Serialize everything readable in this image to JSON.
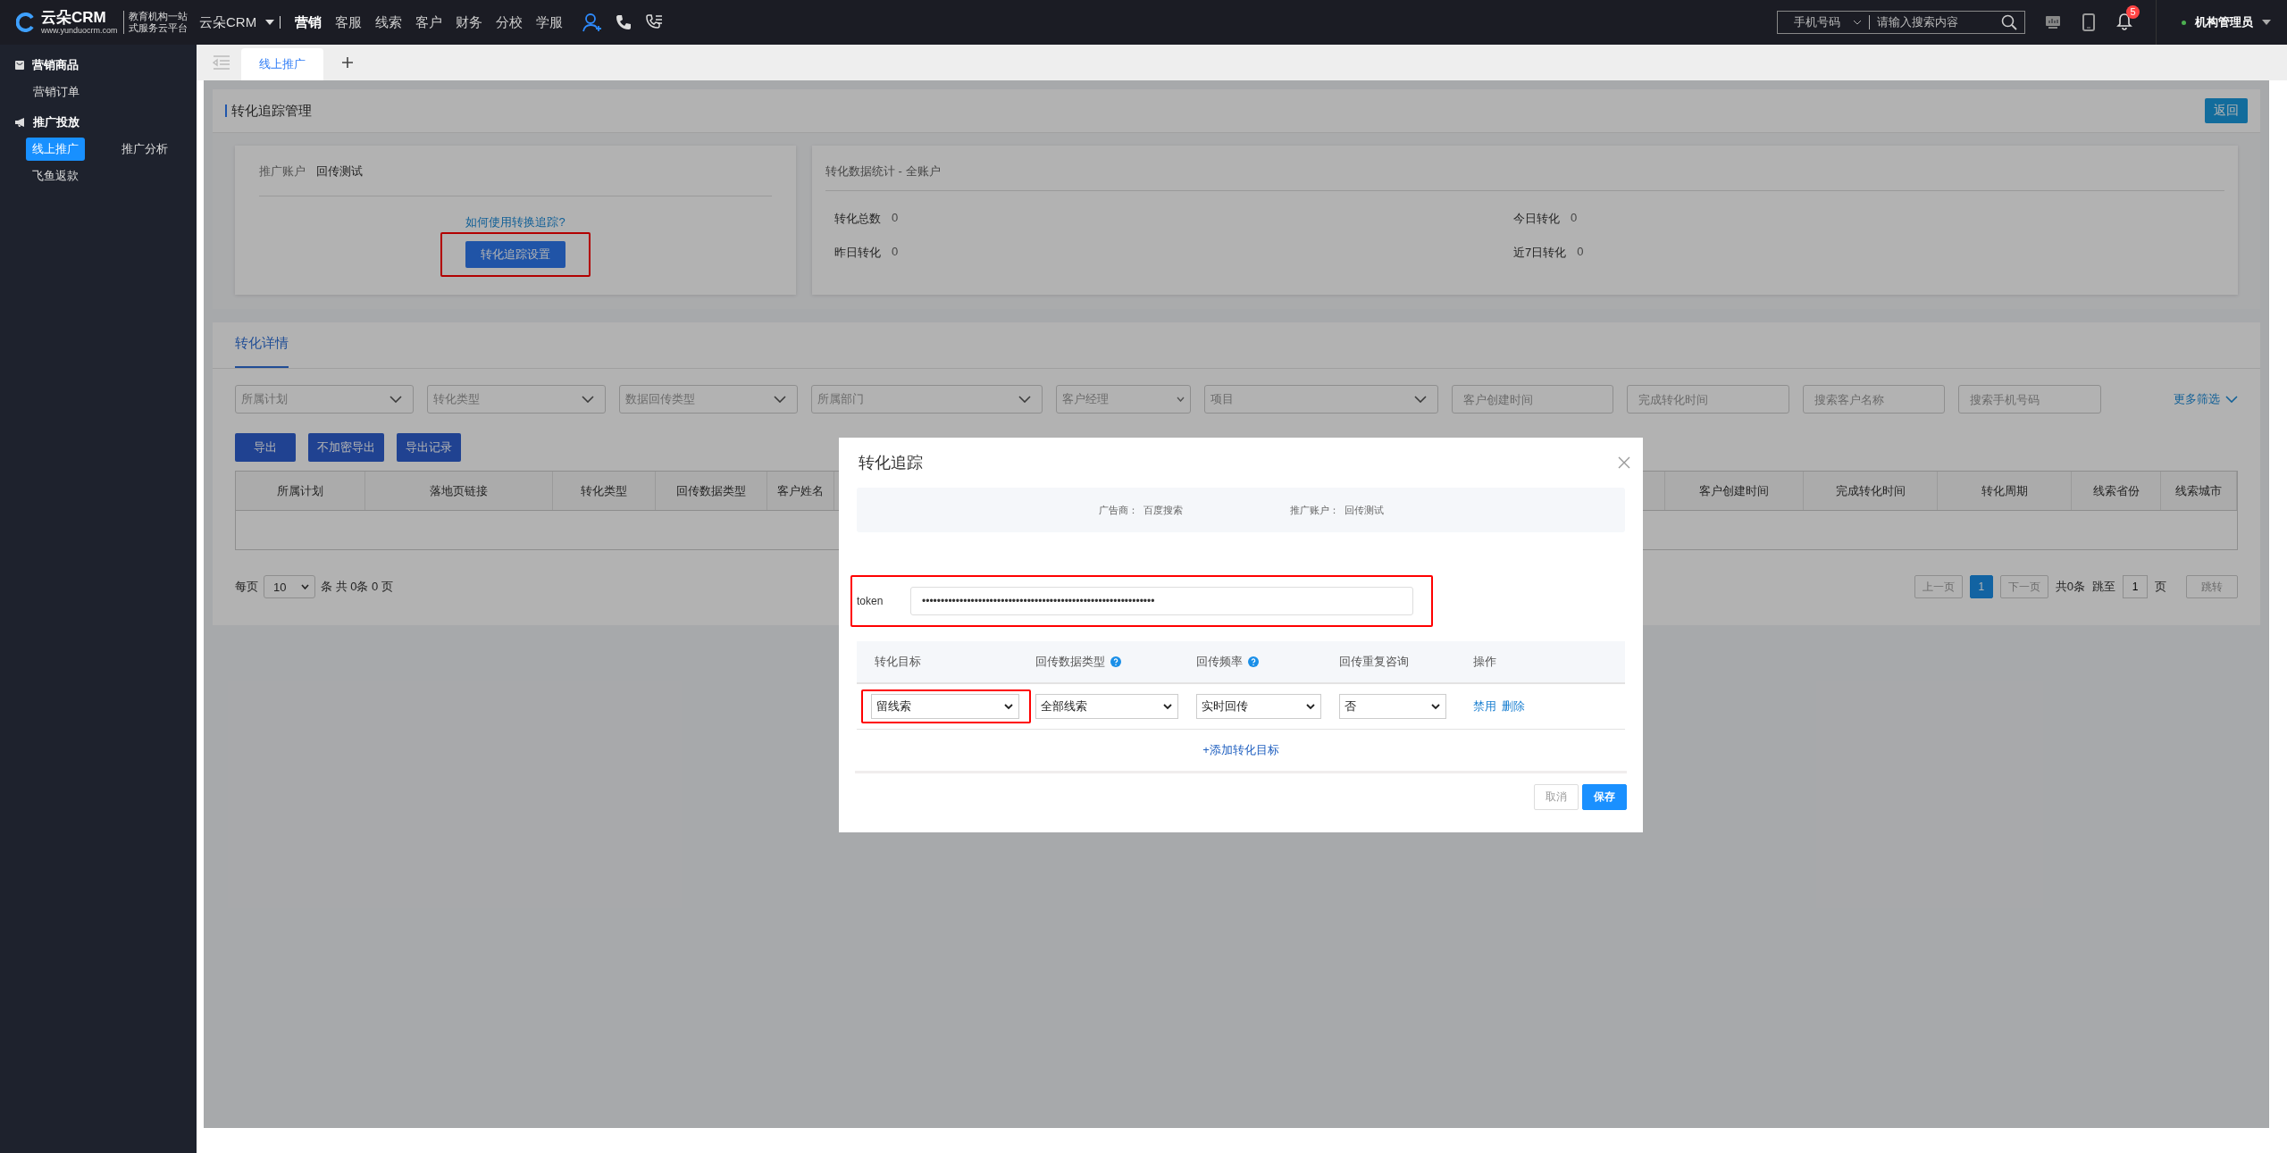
{
  "top_bar": {
    "logo": {
      "brand": "云朵CRM",
      "url": "www.yunduocrm.com",
      "slogan_1": "教育机构一站",
      "slogan_2": "式服务云平台"
    },
    "product": "云朵CRM",
    "nav": [
      {
        "label": "营销",
        "selected": true
      },
      {
        "label": "客服",
        "selected": false
      },
      {
        "label": "线索",
        "selected": false
      },
      {
        "label": "客户",
        "selected": false
      },
      {
        "label": "财务",
        "selected": false
      },
      {
        "label": "分校",
        "selected": false
      },
      {
        "label": "学服",
        "selected": false
      }
    ],
    "search": {
      "field_type": "手机号码",
      "placeholder": "请输入搜索内容"
    },
    "notifications": "5",
    "user": "机构管理员"
  },
  "sidebar": {
    "groups": [
      {
        "label": "营销商品",
        "children": [
          {
            "label": "营销订单",
            "selected": false
          }
        ]
      },
      {
        "label": "推广投放",
        "children": [
          {
            "label": "线上推广",
            "selected": true
          },
          {
            "label": "推广分析",
            "selected": false
          },
          {
            "label": "飞鱼返款",
            "selected": false
          }
        ]
      }
    ]
  },
  "tabs": [
    {
      "label": "线上推广",
      "selected": true
    }
  ],
  "page": {
    "title": "转化追踪管理",
    "back_button": "返回",
    "account_card": {
      "label": "推广账户",
      "value": "回传测试",
      "help_link": "如何使用转换追踪?",
      "setup_button": "转化追踪设置",
      "setup_highlighted": true
    },
    "stats_card": {
      "title": "转化数据统计 - 全账户",
      "stats": [
        {
          "label": "转化总数",
          "value": "0"
        },
        {
          "label": "今日转化",
          "value": "0"
        },
        {
          "label": "昨日转化",
          "value": "0"
        },
        {
          "label": "近7日转化",
          "value": "0"
        }
      ]
    }
  },
  "details": {
    "tabs": [
      {
        "label": "转化详情",
        "selected": true
      }
    ],
    "filters": [
      {
        "kind": "dropdown",
        "placeholder": "所属计划"
      },
      {
        "kind": "dropdown",
        "placeholder": "转化类型"
      },
      {
        "kind": "dropdown",
        "placeholder": "数据回传类型"
      },
      {
        "kind": "dropdown",
        "placeholder": "所属部门"
      },
      {
        "kind": "select",
        "placeholder": "客户经理"
      },
      {
        "kind": "dropdown",
        "placeholder": "项目"
      },
      {
        "kind": "input",
        "placeholder": "客户创建时间"
      },
      {
        "kind": "input",
        "placeholder": "完成转化时间"
      },
      {
        "kind": "input",
        "placeholder": "搜索客户名称"
      },
      {
        "kind": "input",
        "placeholder": "搜索手机号码"
      }
    ],
    "more_filters": "更多筛选",
    "buttons": [
      "导出",
      "不加密导出",
      "导出记录"
    ],
    "table": {
      "columns": [
        "所属计划",
        "落地页链接",
        "转化类型",
        "回传数据类型",
        "客户姓名",
        "客户创建时间",
        "完成转化时间",
        "转化周期",
        "线索省份",
        "线索城市"
      ]
    },
    "pagination": {
      "per_page_label": "每页",
      "per_page": "10",
      "summary": "条 共 0条 0 页",
      "prev": "上一页",
      "pages": [
        {
          "label": "1",
          "selected": true
        }
      ],
      "next": "下一页",
      "total": "共0条",
      "jump_label": "跳至",
      "jump_value": "1",
      "page_unit": "页",
      "jump_button": "跳转"
    }
  },
  "modal": {
    "title": "转化追踪",
    "info": [
      {
        "label": "广告商：",
        "value": "百度搜索"
      },
      {
        "label": "推广账户：",
        "value": "回传测试"
      }
    ],
    "token": {
      "label": "token",
      "value": "••••••••••••••••••••••••••••••••••••••••••••••••••••••••••••••",
      "highlighted": true
    },
    "columns": [
      {
        "label": "转化目标",
        "help": false
      },
      {
        "label": "回传数据类型",
        "help": true
      },
      {
        "label": "回传频率",
        "help": true
      },
      {
        "label": "回传重复咨询",
        "help": false
      },
      {
        "label": "操作",
        "help": false
      }
    ],
    "rows": [
      {
        "target": "留线索",
        "target_highlighted": true,
        "data_type": "全部线索",
        "frequency": "实时回传",
        "repeat": "否",
        "actions": [
          "禁用",
          "删除"
        ]
      }
    ],
    "add_link": "+添加转化目标",
    "buttons": [
      {
        "label": "取消",
        "kind": "secondary"
      },
      {
        "label": "保存",
        "kind": "primary"
      }
    ]
  }
}
